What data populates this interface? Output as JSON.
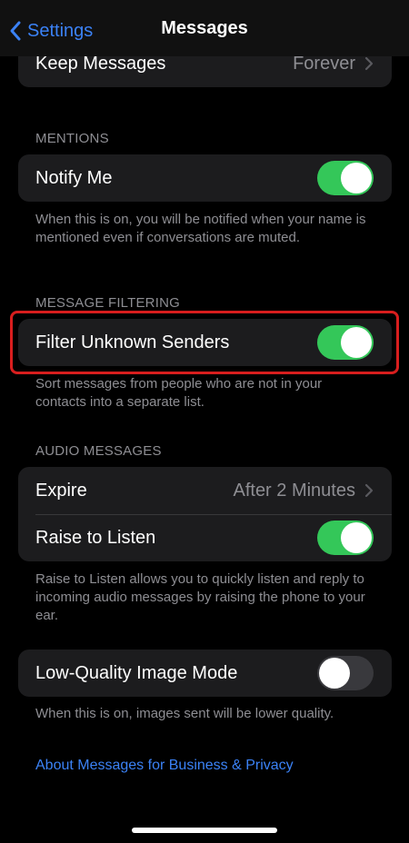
{
  "navbar": {
    "back_label": "Settings",
    "title": "Messages"
  },
  "keep_messages": {
    "label": "Keep Messages",
    "value": "Forever"
  },
  "mentions": {
    "header": "MENTIONS",
    "notify_me": {
      "label": "Notify Me",
      "on": true
    },
    "footnote": "When this is on, you will be notified when your name is mentioned even if conversations are muted."
  },
  "message_filtering": {
    "header": "MESSAGE FILTERING",
    "filter_unknown": {
      "label": "Filter Unknown Senders",
      "on": true
    },
    "footnote": "Sort messages from people who are not in your contacts into a separate list."
  },
  "audio_messages": {
    "header": "AUDIO MESSAGES",
    "expire": {
      "label": "Expire",
      "value": "After 2 Minutes"
    },
    "raise_to_listen": {
      "label": "Raise to Listen",
      "on": true
    },
    "footnote": "Raise to Listen allows you to quickly listen and reply to incoming audio messages by raising the phone to your ear."
  },
  "low_quality": {
    "label": "Low-Quality Image Mode",
    "on": false,
    "footnote": "When this is on, images sent will be lower quality."
  },
  "about_link": "About Messages for Business & Privacy",
  "colors": {
    "accent": "#3b82f6",
    "toggle_on": "#34c759",
    "toggle_off": "#39393d",
    "highlight": "#d81e1e",
    "cell_background": "#1c1c1e"
  }
}
